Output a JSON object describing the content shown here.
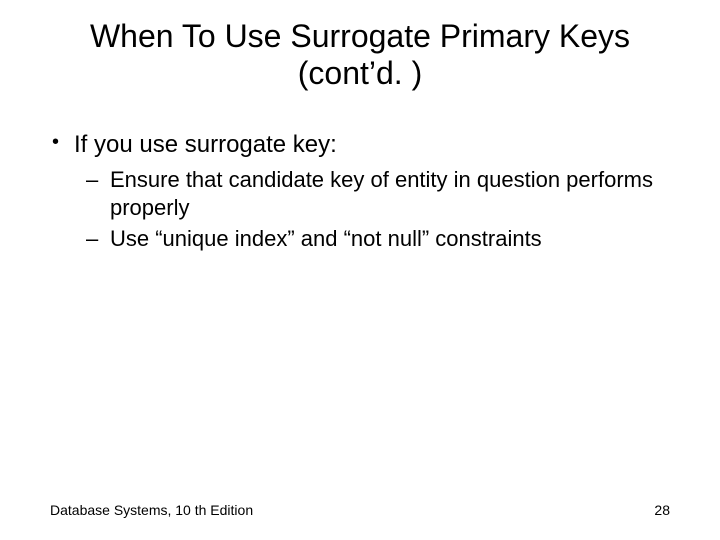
{
  "title_line1": "When To Use Surrogate Primary Keys",
  "title_line2": "(cont’d. )",
  "bullets": {
    "l1_0": "If you use surrogate key:",
    "l2_0": "Ensure that candidate key of entity in question performs properly",
    "l2_1": "Use “unique index” and “not null” constraints"
  },
  "footer": {
    "left": "Database Systems, 10 th Edition",
    "right": "28"
  }
}
